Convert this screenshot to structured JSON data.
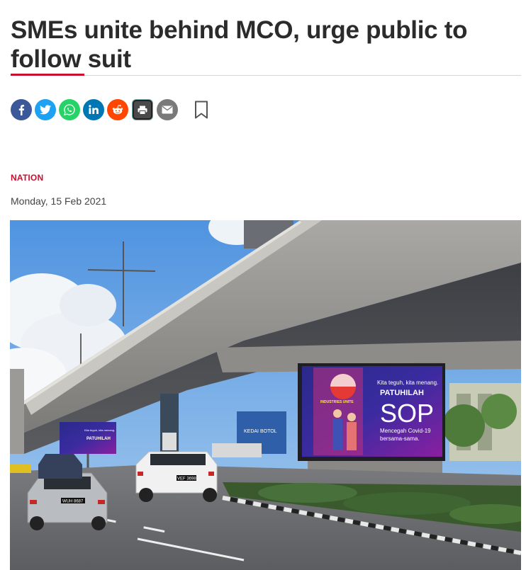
{
  "article": {
    "headline": "SMEs unite behind MCO, urge public to follow suit",
    "section": "NATION",
    "date": "Monday, 15 Feb 2021"
  },
  "share_buttons": [
    {
      "name": "facebook",
      "icon": "facebook-icon",
      "color": "#3b5998"
    },
    {
      "name": "twitter",
      "icon": "twitter-icon",
      "color": "#1da1f2"
    },
    {
      "name": "whatsapp",
      "icon": "whatsapp-icon",
      "color": "#25d366"
    },
    {
      "name": "linkedin",
      "icon": "linkedin-icon",
      "color": "#0077b5"
    },
    {
      "name": "reddit",
      "icon": "reddit-icon",
      "color": "#ff4500"
    },
    {
      "name": "print",
      "icon": "print-icon",
      "color": "#4a4a4a"
    },
    {
      "name": "email",
      "icon": "email-icon",
      "color": "#7a7a7a"
    },
    {
      "name": "bookmark",
      "icon": "bookmark-icon",
      "color": "#555555"
    }
  ],
  "photo": {
    "billboard": {
      "tagline": "Kita teguh, kita menang.",
      "headline_1": "PATUHILAH",
      "headline_2": "SOP",
      "sub_1": "Mencegah Covid-19",
      "sub_2": "bersama-sama.",
      "brand": "INDUSTRIES UNITE"
    },
    "small_billboard": {
      "tagline": "Kita teguh, kita menang.",
      "headline": "PATUHILAH"
    },
    "plates": [
      "VEF 3698",
      "WUH 8687"
    ],
    "wall_text": "KEDAI BOTOL"
  },
  "colors": {
    "accent": "#c8102e",
    "headline": "#2b2b2b"
  }
}
